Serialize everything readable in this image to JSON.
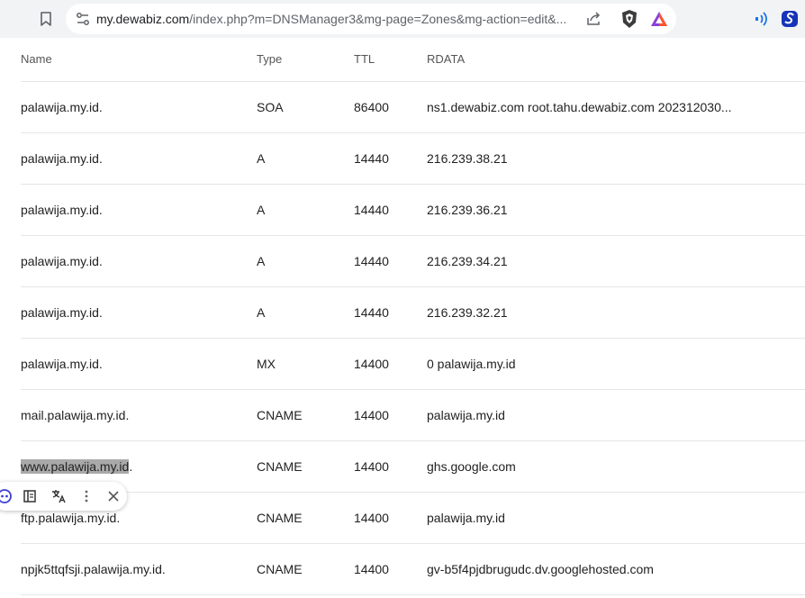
{
  "browser": {
    "url_host": "my.dewabiz.com",
    "url_path": "/index.php?m=DNSManager3&mg-page=Zones&mg-action=edit&..."
  },
  "table": {
    "columns": [
      "Name",
      "Type",
      "TTL",
      "RDATA"
    ],
    "rows": [
      {
        "name": "palawija.my.id.",
        "type": "SOA",
        "ttl": "86400",
        "rdata": "ns1.dewabiz.com root.tahu.dewabiz.com 202312030..."
      },
      {
        "name": "palawija.my.id.",
        "type": "A",
        "ttl": "14440",
        "rdata": "216.239.38.21"
      },
      {
        "name": "palawija.my.id.",
        "type": "A",
        "ttl": "14440",
        "rdata": "216.239.36.21"
      },
      {
        "name": "palawija.my.id.",
        "type": "A",
        "ttl": "14440",
        "rdata": "216.239.34.21"
      },
      {
        "name": "palawija.my.id.",
        "type": "A",
        "ttl": "14440",
        "rdata": "216.239.32.21"
      },
      {
        "name": "palawija.my.id.",
        "type": "MX",
        "ttl": "14400",
        "rdata": "0 palawija.my.id"
      },
      {
        "name": "mail.palawija.my.id.",
        "type": "CNAME",
        "ttl": "14400",
        "rdata": "palawija.my.id"
      },
      {
        "name": "www.palawija.my.id",
        "name_suffix": ".",
        "type": "CNAME",
        "ttl": "14400",
        "rdata": "ghs.google.com"
      },
      {
        "name": "ftp.palawija.my.id.",
        "type": "CNAME",
        "ttl": "14400",
        "rdata": "palawija.my.id"
      },
      {
        "name": "npjk5ttqfsji.palawija.my.id.",
        "type": "CNAME",
        "ttl": "14400",
        "rdata": "gv-b5f4pjdbrugudc.dv.googlehosted.com"
      }
    ]
  },
  "selection_popup": {
    "icons": [
      "ai-chat-icon",
      "reader-icon",
      "translate-icon",
      "more-icon",
      "close-icon"
    ]
  },
  "colors": {
    "toolbar_bg": "#f1f3f4",
    "selection": "#a9a9a9",
    "brave_orange": "#fb542b",
    "extension_blue": "#1a73e8"
  }
}
